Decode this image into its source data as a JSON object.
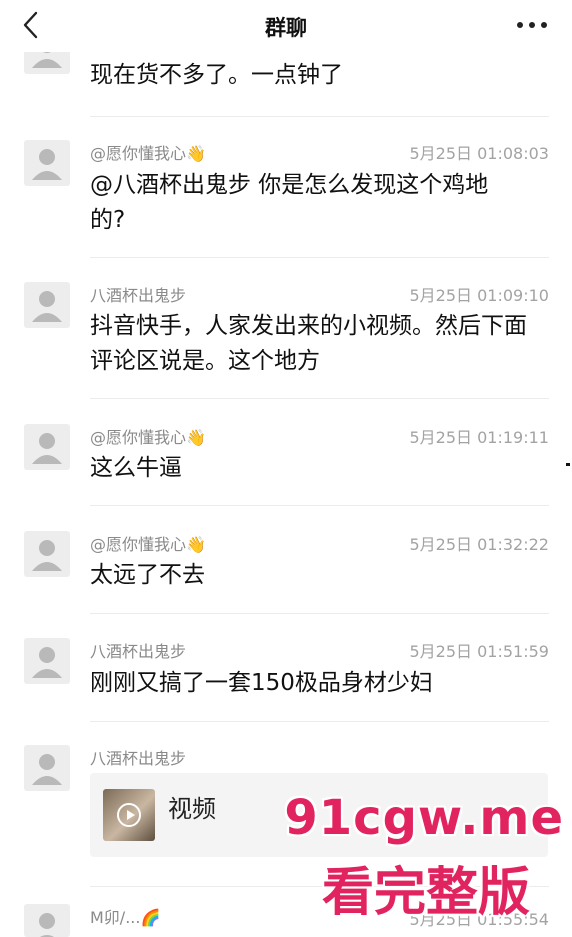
{
  "header": {
    "title": "群聊",
    "back_icon": "chevron-left-icon",
    "more_icon": "ellipsis-icon"
  },
  "messages": [
    {
      "name": "",
      "time": "",
      "text": "现在货不多了。一点钟了"
    },
    {
      "name": "@愿你懂我心👋",
      "time": "5月25日 01:08:03",
      "text": "@八酒杯出鬼步 你是怎么发现这个鸡地的?"
    },
    {
      "name": "八酒杯出鬼步",
      "time": "5月25日 01:09:10",
      "text": "抖音快手，人家发出来的小视频。然后下面评论区说是。这个地方"
    },
    {
      "name": "@愿你懂我心👋",
      "time": "5月25日 01:19:11",
      "text": "这么牛逼"
    },
    {
      "name": "@愿你懂我心👋",
      "time": "5月25日 01:32:22",
      "text": "太远了不去"
    },
    {
      "name": "八酒杯出鬼步",
      "time": "5月25日 01:51:59",
      "text": "刚刚又搞了一套150极品身材少妇"
    },
    {
      "name": "八酒杯出鬼步",
      "time": "",
      "text": ""
    },
    {
      "name": "M卯/...🌈",
      "time": "5月25日 01:55:54",
      "text": ""
    }
  ],
  "video_card": {
    "title": "视频",
    "icon": "play-icon"
  },
  "watermark": {
    "line1": "91cgw.me",
    "line2": "看完整版",
    "color": "#e1245f"
  }
}
